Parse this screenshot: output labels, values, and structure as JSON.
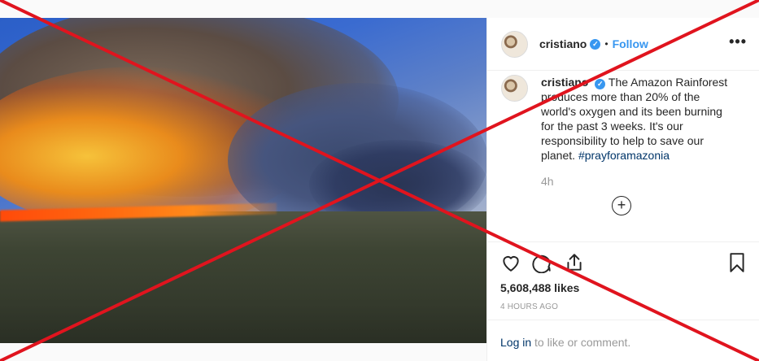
{
  "post": {
    "username": "cristiano",
    "verified_glyph": "✓",
    "separator": "•",
    "follow_label": "Follow",
    "more_glyph": "•••",
    "caption": {
      "username": "cristiano",
      "text": "The Amazon Rainforest produces more than 20% of the world's oxygen and its been burning for the past 3 weeks. It's our responsibility to help to save our planet.",
      "hashtag": "#prayforamazonia"
    },
    "comment_time": "4h",
    "load_more_glyph": "+",
    "likes": "5,608,488 likes",
    "posted_ago": "4 HOURS AGO",
    "login_link": "Log in",
    "login_suffix": " to like or comment."
  },
  "icons": [
    "heart-icon",
    "comment-icon",
    "share-icon",
    "bookmark-icon",
    "verified-badge-icon",
    "add-comment-icon"
  ],
  "colors": {
    "accent": "#3897f0",
    "link": "#003569",
    "muted": "#999999",
    "overlay_cross": "#e0141e"
  }
}
